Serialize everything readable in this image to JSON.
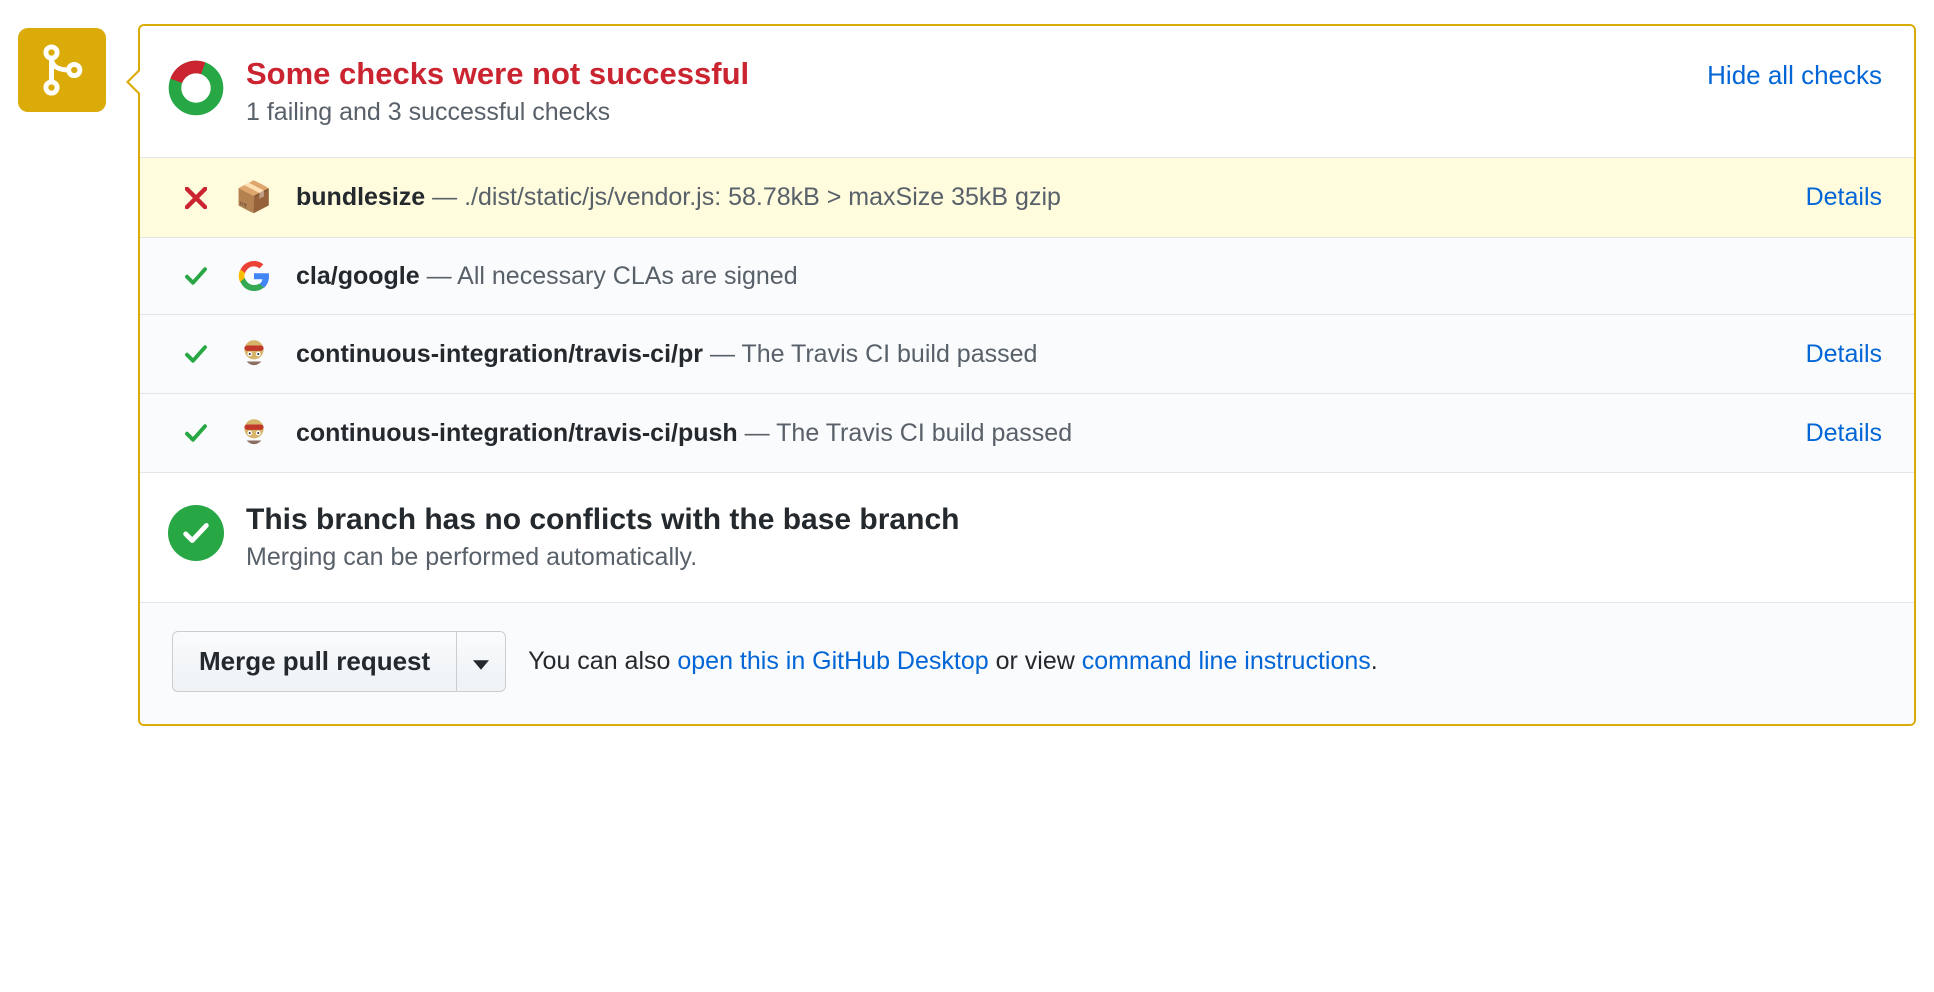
{
  "header": {
    "title": "Some checks were not successful",
    "subtitle": "1 failing and 3 successful checks",
    "toggle_label": "Hide all checks"
  },
  "checks": [
    {
      "status": "fail",
      "icon": "package-icon",
      "glyph": "📦",
      "name": "bundlesize",
      "desc": "./dist/static/js/vendor.js: 58.78kB > maxSize 35kB gzip",
      "details_label": "Details",
      "has_details": true
    },
    {
      "status": "pass",
      "icon": "google-icon",
      "glyph": "G",
      "name": "cla/google",
      "desc": "All necessary CLAs are signed",
      "details_label": "",
      "has_details": false
    },
    {
      "status": "pass",
      "icon": "travis-icon",
      "glyph": "👷",
      "name": "continuous-integration/travis-ci/pr",
      "desc": "The Travis CI build passed",
      "details_label": "Details",
      "has_details": true
    },
    {
      "status": "pass",
      "icon": "travis-icon",
      "glyph": "👷",
      "name": "continuous-integration/travis-ci/push",
      "desc": "The Travis CI build passed",
      "details_label": "Details",
      "has_details": true
    }
  ],
  "merge_status": {
    "title": "This branch has no conflicts with the base branch",
    "subtitle": "Merging can be performed automatically."
  },
  "actions": {
    "merge_button_label": "Merge pull request",
    "hint_prefix": "You can also ",
    "desktop_link": "open this in GitHub Desktop",
    "hint_middle": " or view ",
    "cli_link": "command line instructions",
    "hint_suffix": "."
  }
}
